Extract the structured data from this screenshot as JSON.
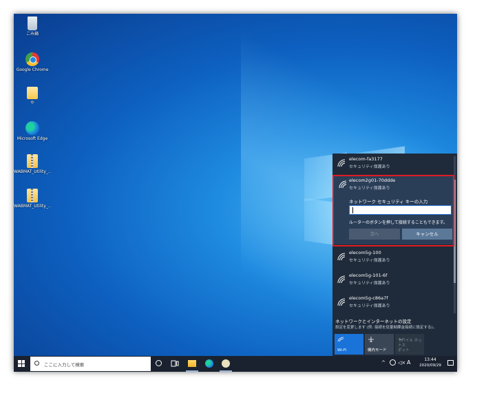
{
  "desktop": {
    "icons": [
      {
        "label": "ごみ箱"
      },
      {
        "label": "Google Chrome"
      },
      {
        "label": "や"
      },
      {
        "label": "Microsoft Edge"
      },
      {
        "label": "WABMAT_Utility_..."
      },
      {
        "label": "WABMAT_Utility_..."
      }
    ]
  },
  "flyout": {
    "networks": [
      {
        "name": "elecom-fa3177",
        "security": "セキュリティ保護あり"
      },
      {
        "name": "elecom2g01-70ddde",
        "security": "セキュリティ保護あり"
      },
      {
        "name": "elecom5g-100",
        "security": "セキュリティ保護あり"
      },
      {
        "name": "elecom5g-101-6f",
        "security": "セキュリティ保護あり"
      },
      {
        "name": "elecom5g-c86a7f",
        "security": "セキュリティ保護あり"
      }
    ],
    "connect": {
      "label": "ネットワーク セキュリティ キーの入力",
      "key_value": "",
      "hint": "ルーターのボタンを押して接続することもできます。",
      "next_label": "次へ",
      "cancel_label": "キャンセル"
    },
    "settings": {
      "title": "ネットワークとインターネットの設定",
      "description": "設定を変更します (例: 接続を従量制課金接続に設定する)。"
    },
    "quick_actions": {
      "wifi": "Wi-Fi",
      "airplane": "機内モード",
      "hotspot_line1": "モバイル ホットス",
      "hotspot_line2": "ポット"
    }
  },
  "taskbar": {
    "search_placeholder": "ここに入力して検索",
    "time": "13:44",
    "date": "2020/09/29",
    "ime": "A"
  },
  "colors": {
    "highlight": "#e31b23",
    "accent": "#1a73d9"
  }
}
